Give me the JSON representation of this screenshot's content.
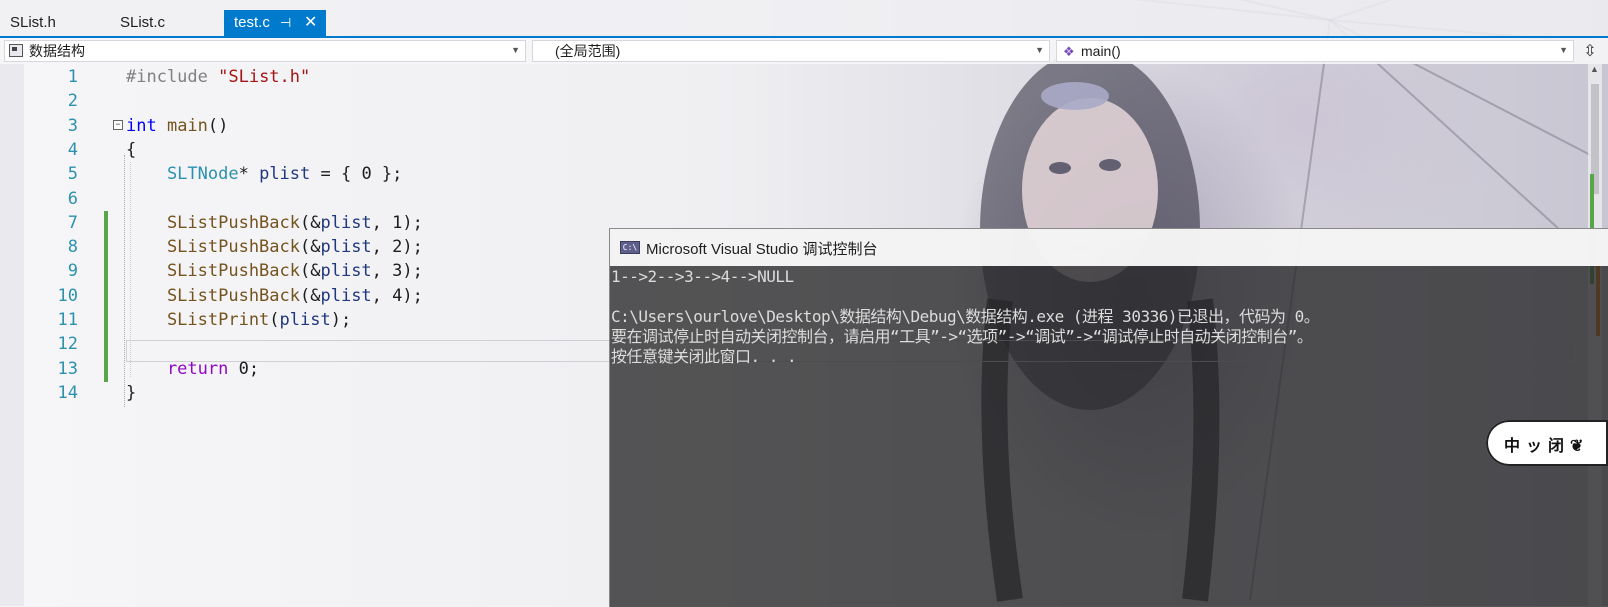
{
  "tabs": [
    {
      "label": "SList.h"
    },
    {
      "label": "SList.c"
    },
    {
      "label": "test.c",
      "pin_icon": "pin-icon",
      "close_icon": "close-icon"
    }
  ],
  "navbar": {
    "project": "数据结构",
    "scope": "(全局范围)",
    "member": "main()"
  },
  "editor": {
    "line_numbers": [
      "1",
      "2",
      "3",
      "4",
      "5",
      "6",
      "7",
      "8",
      "9",
      "10",
      "11",
      "12",
      "13",
      "14"
    ],
    "changed_lines": [
      7,
      8,
      9,
      10,
      11,
      12,
      13
    ]
  },
  "console": {
    "title": "Microsoft Visual Studio 调试控制台",
    "icon_label": "C:\\",
    "lines": [
      "1-->2-->3-->4-->NULL",
      "",
      "C:\\Users\\ourlove\\Desktop\\数据结构\\Debug\\数据结构.exe (进程 30336)已退出，代码为 0。",
      "要在调试停止时自动关闭控制台，请启用“工具”->“选项”->“调试”->“调试停止时自动关闭控制台”。",
      "按任意键关闭此窗口. . ."
    ]
  },
  "widget": {
    "text": "中ッ闭❦"
  },
  "colors": {
    "accent": "#007acc",
    "change_bar": "#57a64a"
  }
}
